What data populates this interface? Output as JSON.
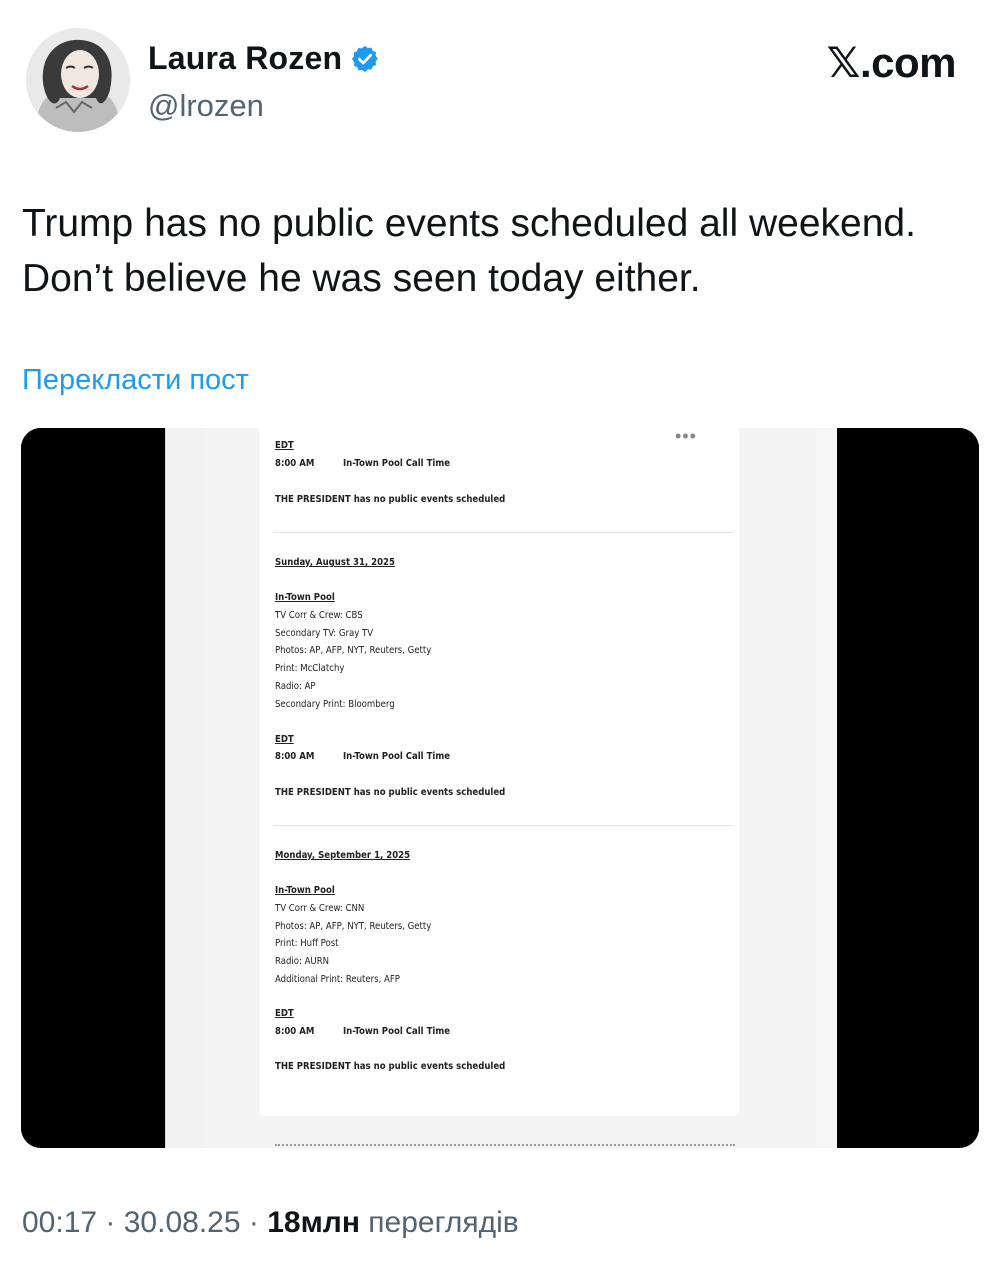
{
  "author": {
    "display_name": "Laura Rozen",
    "handle": "@lrozen",
    "verified_icon": "verified-badge-icon"
  },
  "brand": "𝕏.com",
  "tweet": {
    "line1": "Trump has no public events scheduled all weekend.",
    "line2": "Don’t believe he was seen today either."
  },
  "translate_link": "Перекласти пост",
  "document": {
    "block1": {
      "edt": "EDT",
      "time": "8:00 AM",
      "call": "In-Town Pool Call Time",
      "note": "THE PRESIDENT has no public events scheduled"
    },
    "block2": {
      "date": "Sunday, August 31, 2025",
      "pool": "In-Town Pool",
      "lines": [
        "TV Corr & Crew: CBS",
        "Secondary TV: Gray TV",
        "Photos: AP, AFP, NYT, Reuters, Getty",
        "Print: McClatchy",
        "Radio: AP",
        "Secondary Print: Bloomberg"
      ],
      "edt": "EDT",
      "time": "8:00 AM",
      "call": "In-Town Pool Call Time",
      "note": "THE PRESIDENT has no public events scheduled"
    },
    "block3": {
      "date": "Monday, September 1, 2025",
      "pool": "In-Town Pool",
      "lines": [
        "TV Corr & Crew: CNN",
        "Photos: AP, AFP, NYT, Reuters, Getty",
        "Print: Huff Post",
        "Radio: AURN",
        "Additional Print: Reuters, AFP"
      ],
      "edt": "EDT",
      "time": "8:00 AM",
      "call": "In-Town Pool Call Time",
      "note": "THE PRESIDENT has no public events scheduled"
    }
  },
  "meta": {
    "time": "00:17",
    "sep1": " · ",
    "date": "30.08.25",
    "sep2": " · ",
    "views_count": "18млн",
    "views_label": " переглядів"
  }
}
